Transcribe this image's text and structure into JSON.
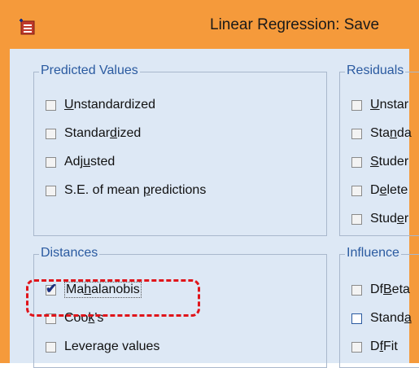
{
  "window": {
    "title": "Linear Regression: Save",
    "icon": "spss-dialog-icon",
    "accent_color": "#f59a3b"
  },
  "predicted_values": {
    "legend": "Predicted Values",
    "items": [
      {
        "pre": "",
        "ul": "U",
        "post": "nstandardized",
        "checked": false
      },
      {
        "pre": "Standar",
        "ul": "d",
        "post": "ized",
        "checked": false
      },
      {
        "pre": "Adj",
        "ul": "u",
        "post": "sted",
        "checked": false
      },
      {
        "pre": "S.E. of mean ",
        "ul": "p",
        "post": "redictions",
        "checked": false
      }
    ]
  },
  "residuals": {
    "legend": "Residuals",
    "items": [
      {
        "pre": "",
        "ul": "U",
        "post": "nstar",
        "checked": false
      },
      {
        "pre": "Sta",
        "ul": "n",
        "post": "da",
        "checked": false
      },
      {
        "pre": "",
        "ul": "S",
        "post": "tuder",
        "checked": false
      },
      {
        "pre": "D",
        "ul": "e",
        "post": "lete",
        "checked": false
      },
      {
        "pre": "Stud",
        "ul": "e",
        "post": "r",
        "checked": false
      }
    ]
  },
  "distances": {
    "legend": "Distances",
    "items": [
      {
        "pre": "Ma",
        "ul": "h",
        "post": "alanobis",
        "checked": true
      },
      {
        "pre": "Coo",
        "ul": "k",
        "post": "'s",
        "checked": false
      },
      {
        "pre": "Levera",
        "ul": "g",
        "post": "e values",
        "checked": false
      }
    ]
  },
  "influence": {
    "legend": "Influence",
    "items": [
      {
        "pre": "Df",
        "ul": "B",
        "post": "eta",
        "checked": false
      },
      {
        "pre": "Stand",
        "ul": "a",
        "post": "",
        "checked": false
      },
      {
        "pre": "D",
        "ul": "f",
        "post": "Fit",
        "checked": false
      }
    ]
  },
  "highlight_color": "#e0141a"
}
